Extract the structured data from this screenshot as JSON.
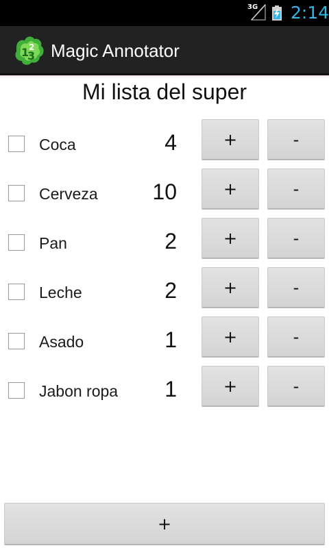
{
  "status_bar": {
    "network": "3G",
    "time": "2:14",
    "clock_color": "#33b5e5",
    "icons": [
      "signal-icon",
      "battery-charging-icon"
    ]
  },
  "action_bar": {
    "title": "Magic Annotator",
    "icon": "app-logo-icon",
    "background": "#222222"
  },
  "list": {
    "title": "Mi lista del super",
    "plus_label": "+",
    "minus_label": "-",
    "items": [
      {
        "label": "Coca",
        "quantity": "4",
        "checked": false
      },
      {
        "label": "Cerveza",
        "quantity": "10",
        "checked": false
      },
      {
        "label": "Pan",
        "quantity": "2",
        "checked": false
      },
      {
        "label": "Leche",
        "quantity": "2",
        "checked": false
      },
      {
        "label": "Asado",
        "quantity": "1",
        "checked": false
      },
      {
        "label": "Jabon ropa",
        "quantity": "1",
        "checked": false
      }
    ]
  },
  "footer": {
    "add_label": "+"
  }
}
